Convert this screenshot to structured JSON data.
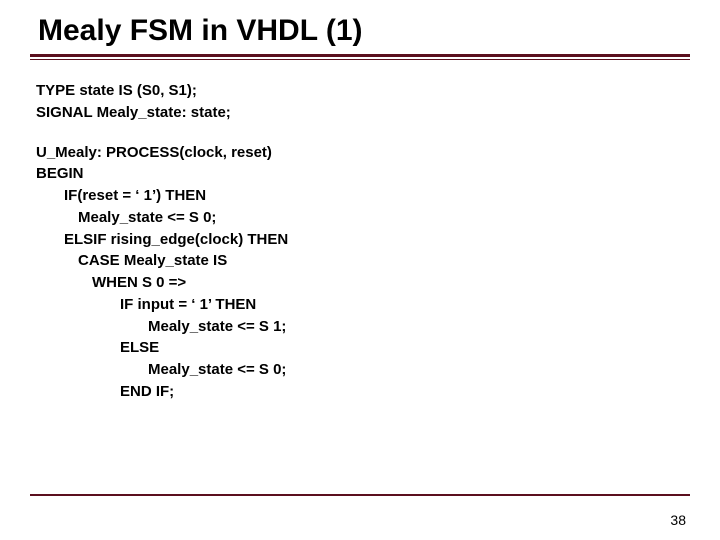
{
  "title": "Mealy FSM in VHDL (1)",
  "code": {
    "l1": "TYPE state IS (S0, S1);",
    "l2": "SIGNAL Mealy_state: state;",
    "l3": "U_Mealy: PROCESS(clock, reset)",
    "l4": "BEGIN",
    "l5": "IF(reset = ‘ 1’) THEN",
    "l6": "Mealy_state <= S 0;",
    "l7": "ELSIF rising_edge(clock) THEN",
    "l8": "CASE Mealy_state IS",
    "l9": "WHEN S 0 =>",
    "l10": "IF input = ‘ 1’ THEN",
    "l11": "Mealy_state <= S 1;",
    "l12": "ELSE",
    "l13": "Mealy_state <= S 0;",
    "l14": "END IF;"
  },
  "page_number": "38"
}
